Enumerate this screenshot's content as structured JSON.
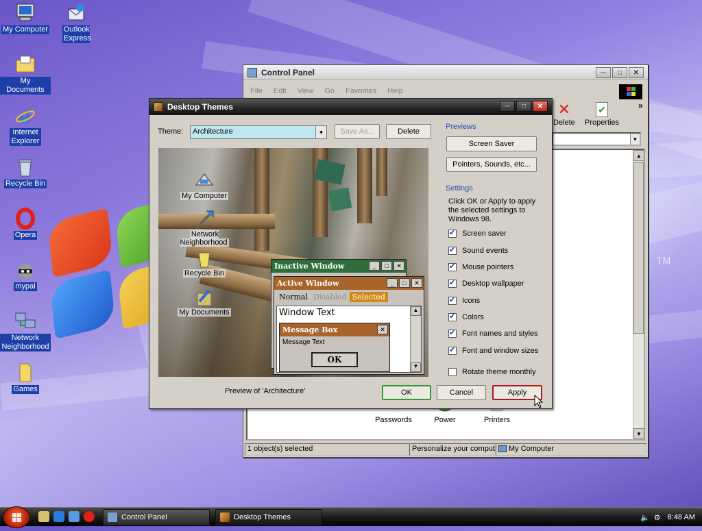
{
  "desktop": {
    "icons": [
      {
        "label": "My Computer"
      },
      {
        "label": "Outlook Express"
      },
      {
        "label": "My Documents"
      },
      {
        "label": "Internet Explorer"
      },
      {
        "label": "Recycle Bin"
      },
      {
        "label": "Opera"
      },
      {
        "label": "mypal"
      },
      {
        "label": "Network Neighborhood"
      },
      {
        "label": "Games"
      }
    ],
    "wallpaper_tm": "TM"
  },
  "control_panel": {
    "title": "Control Panel",
    "menu": [
      "File",
      "Edit",
      "View",
      "Go",
      "Favorites",
      "Help"
    ],
    "toolbar": {
      "delete": "Delete",
      "properties": "Properties",
      "more": "»"
    },
    "items": [
      {
        "label": "Passwords"
      },
      {
        "label": "Power"
      },
      {
        "label": "Printers"
      }
    ],
    "status": {
      "selected": "1 object(s) selected",
      "desc": "Personalize your compute",
      "zone": "My Computer"
    }
  },
  "dialog": {
    "title": "Desktop Themes",
    "theme_label": "Theme:",
    "theme_value": "Architecture",
    "save_as": "Save As...",
    "delete": "Delete",
    "previews_heading": "Previews",
    "screen_saver_btn": "Screen Saver",
    "pointers_btn": "Pointers, Sounds, etc...",
    "settings_heading": "Settings",
    "settings_text": "Click OK or Apply to apply the selected settings to Windows 98.",
    "settings": [
      {
        "label": "Screen saver",
        "checked": true
      },
      {
        "label": "Sound events",
        "checked": true
      },
      {
        "label": "Mouse pointers",
        "checked": true
      },
      {
        "label": "Desktop wallpaper",
        "checked": true
      },
      {
        "label": "Icons",
        "checked": true
      },
      {
        "label": "Colors",
        "checked": true
      },
      {
        "label": "Font names and styles",
        "checked": true
      },
      {
        "label": "Font and window sizes",
        "checked": true
      }
    ],
    "rotate": {
      "label": "Rotate theme monthly",
      "checked": false
    },
    "preview_caption": "Preview of 'Architecture'",
    "ok": "OK",
    "cancel": "Cancel",
    "apply": "Apply",
    "preview": {
      "icons": [
        "My Computer",
        "Network Neighborhood",
        "Recycle Bin",
        "My Documents"
      ],
      "inactive_title": "Inactive Window",
      "active_title": "Active Window",
      "menu_normal": "Normal",
      "menu_disabled": "Disabled",
      "menu_selected": "Selected",
      "window_text": "Window Text",
      "msgbox_title": "Message Box",
      "msgbox_text": "Message Text",
      "msgbox_ok": "OK"
    },
    "colors": {
      "inactive": "#2f6e3a",
      "active": "#a8642a",
      "selected_bg": "#d08a1a"
    }
  },
  "taskbar": {
    "tasks": [
      {
        "label": "Control Panel"
      },
      {
        "label": "Desktop Themes"
      }
    ],
    "clock": "8:48 AM"
  }
}
